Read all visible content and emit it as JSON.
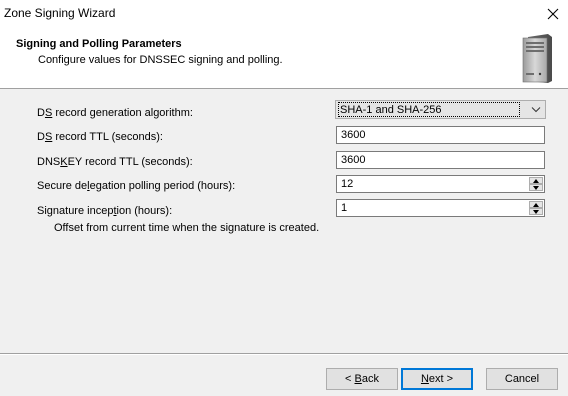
{
  "window": {
    "title": "Zone Signing Wizard",
    "close_icon": "close-icon"
  },
  "header": {
    "title": "Signing and Polling Parameters",
    "subtitle": "Configure values for DNSSEC signing and polling.",
    "icon": "server-icon"
  },
  "form": {
    "ds_algorithm": {
      "label_pre": "D",
      "label_access": "S",
      "label_post": " record generation algorithm:",
      "value": "SHA-1 and SHA-256"
    },
    "ds_ttl": {
      "label_pre": "D",
      "label_access": "S",
      "label_post": " record TTL (seconds):",
      "value": "3600"
    },
    "dnskey_ttl": {
      "label_pre": "DNS",
      "label_access": "K",
      "label_post": "EY record TTL (seconds):",
      "value": "3600"
    },
    "polling_period": {
      "label_pre": "Secure de",
      "label_access": "l",
      "label_post": "egation polling period (hours):",
      "value": "12"
    },
    "signature_inception": {
      "label_pre": "Signature incep",
      "label_access": "t",
      "label_post": "ion (hours):",
      "value": "1",
      "hint": "Offset from current time when the signature is created."
    }
  },
  "buttons": {
    "back": {
      "pre": "< ",
      "access": "B",
      "post": "ack"
    },
    "next": {
      "pre": "",
      "access": "N",
      "post": "ext >"
    },
    "cancel": {
      "label": "Cancel"
    }
  }
}
